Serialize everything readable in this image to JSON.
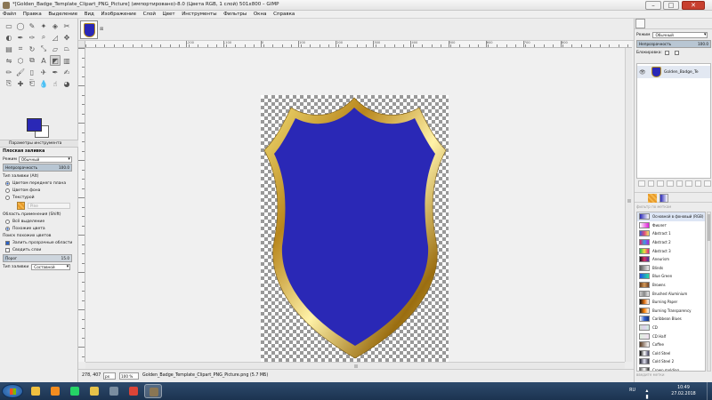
{
  "window": {
    "title": "*[Golden_Badge_Template_Clipart_PNG_Picture] (импортировано)-8.0 (Цвета RGB, 1 слой) 501x800 – GIMP",
    "min": "–",
    "max": "□",
    "close": "✕"
  },
  "menu": [
    "Файл",
    "Правка",
    "Выделение",
    "Вид",
    "Изображение",
    "Слой",
    "Цвет",
    "Инструменты",
    "Фильтры",
    "Окна",
    "Справка"
  ],
  "toolbox": {
    "tools": [
      "rect-select",
      "ellipse-select",
      "free-select",
      "fuzzy-select",
      "color-select",
      "scissors",
      "foreground-select",
      "paths",
      "color-picker",
      "zoom",
      "measure",
      "move",
      "align",
      "crop",
      "rotate",
      "scale",
      "shear",
      "perspective",
      "flip",
      "cage",
      "unified-transform",
      "text",
      "bucket-fill",
      "blend",
      "pencil",
      "paintbrush",
      "eraser",
      "airbrush",
      "ink",
      "mypaint",
      "clone",
      "heal",
      "perspective-clone",
      "blur",
      "smudge",
      "dodge-burn"
    ],
    "active_tool": "bucket-fill",
    "fg_color": "#2a28b6",
    "bg_color": "#ffffff"
  },
  "tool_options": {
    "tab_label": "Параметры инструмента",
    "title": "Плоская заливка",
    "mode_label": "Режим",
    "mode_value": "Обычный",
    "opacity_label": "Непрозрачность",
    "opacity_value": "100.0",
    "fill_type_label": "Тип заливки  (Alt)",
    "fill_fg": "Цветом переднего плана",
    "fill_bg": "Цветом фона",
    "fill_pattern": "Текстурой",
    "pattern_name": "Pine",
    "affected_label": "Область применения  (Shift)",
    "affected_all": "Всё выделение",
    "affected_similar": "Похожие цвета",
    "similar_label": "Поиск похожих цветов",
    "fill_transparent": "Залить прозрачные области",
    "sample_merged": "Сводить слои",
    "threshold_label": "Порог",
    "threshold_value": "15.0",
    "fill_by_label": "Тип заливки",
    "fill_by_value": "Составной"
  },
  "status": {
    "coords": "278, 407",
    "unit": "px",
    "zoom": "100 %",
    "message": "Golden_Badge_Template_Clipart_PNG_Picture.png (5.7 МБ)"
  },
  "ruler_labels": [
    "-200",
    "-100",
    "0",
    "100",
    "200",
    "300",
    "400",
    "500",
    "600",
    "700",
    "800"
  ],
  "layers": {
    "mode_label": "Режим",
    "mode_value": "Обычный",
    "opacity_label": "Непрозрачность",
    "opacity_value": "100.0",
    "lock_label": "Блокировка:",
    "layer_name": "Golden_Badge_Te"
  },
  "gradients": {
    "filter_placeholder": "фильтр по меткам",
    "tag_placeholder": "введите метки",
    "items": [
      {
        "name": "Основной в фоновый (RGB)",
        "colors": [
          "#2a28b6",
          "#ffffff"
        ]
      },
      {
        "name": "Фиолет",
        "colors": [
          "#ffffff",
          "#e11ad8"
        ]
      },
      {
        "name": "Abstract 1",
        "colors": [
          "#3b5bdb",
          "#e04a7a",
          "#f5e96a"
        ]
      },
      {
        "name": "Abstract 2",
        "colors": [
          "#e0206a",
          "#3aa0e0",
          "#b020e0"
        ]
      },
      {
        "name": "Abstract 3",
        "colors": [
          "#22bb55",
          "#f0e040",
          "#e02080"
        ]
      },
      {
        "name": "Aneurism",
        "colors": [
          "#101020",
          "#e03060",
          "#4030a0"
        ]
      },
      {
        "name": "Blinds",
        "colors": [
          "#555555",
          "#eeeeee"
        ]
      },
      {
        "name": "Blue Green",
        "colors": [
          "#1d4fe8",
          "#28e0a0"
        ]
      },
      {
        "name": "Browns",
        "colors": [
          "#6a3a14",
          "#d49a5a",
          "#704020"
        ]
      },
      {
        "name": "Brushed Aluminium",
        "colors": [
          "#cccccc",
          "#888888",
          "#eeeeee"
        ]
      },
      {
        "name": "Burning Paper",
        "colors": [
          "#111111",
          "#e07010",
          "#ffffff"
        ]
      },
      {
        "name": "Burning Transparency",
        "colors": [
          "#222222",
          "#ff8000",
          "#ffffff"
        ]
      },
      {
        "name": "Caribbean Blues",
        "colors": [
          "#ffffff",
          "#3060d0",
          "#103080"
        ]
      },
      {
        "name": "CD",
        "colors": [
          "#d0e0d0",
          "#e0d0f0",
          "#d0f0e0"
        ]
      },
      {
        "name": "CD Half",
        "colors": [
          "#e0f0e0",
          "#f0e0f0"
        ]
      },
      {
        "name": "Coffee",
        "colors": [
          "#5a3a20",
          "#ffffff"
        ]
      },
      {
        "name": "Cold Steel",
        "colors": [
          "#000000",
          "#ffffff",
          "#404060"
        ]
      },
      {
        "name": "Cold Steel 2",
        "colors": [
          "#202030",
          "#e0e0f0",
          "#303040"
        ]
      },
      {
        "name": "Crown molding",
        "colors": [
          "#666666",
          "#ffffff",
          "#333333"
        ]
      }
    ]
  },
  "taskbar": {
    "lang": "RU",
    "time": "10:49",
    "date": "27.02.2018",
    "apps": [
      {
        "name": "windows-explorer-icon",
        "color": "#f0c040"
      },
      {
        "name": "media-player-icon",
        "color": "#f28c1f"
      },
      {
        "name": "whatsapp-icon",
        "color": "#25d366"
      },
      {
        "name": "file-manager-icon",
        "color": "#e6c24a"
      },
      {
        "name": "calculator-icon",
        "color": "#7a8da0"
      },
      {
        "name": "chrome-icon",
        "color": "#db4437"
      },
      {
        "name": "gimp-icon",
        "color": "#8a7654"
      }
    ]
  }
}
